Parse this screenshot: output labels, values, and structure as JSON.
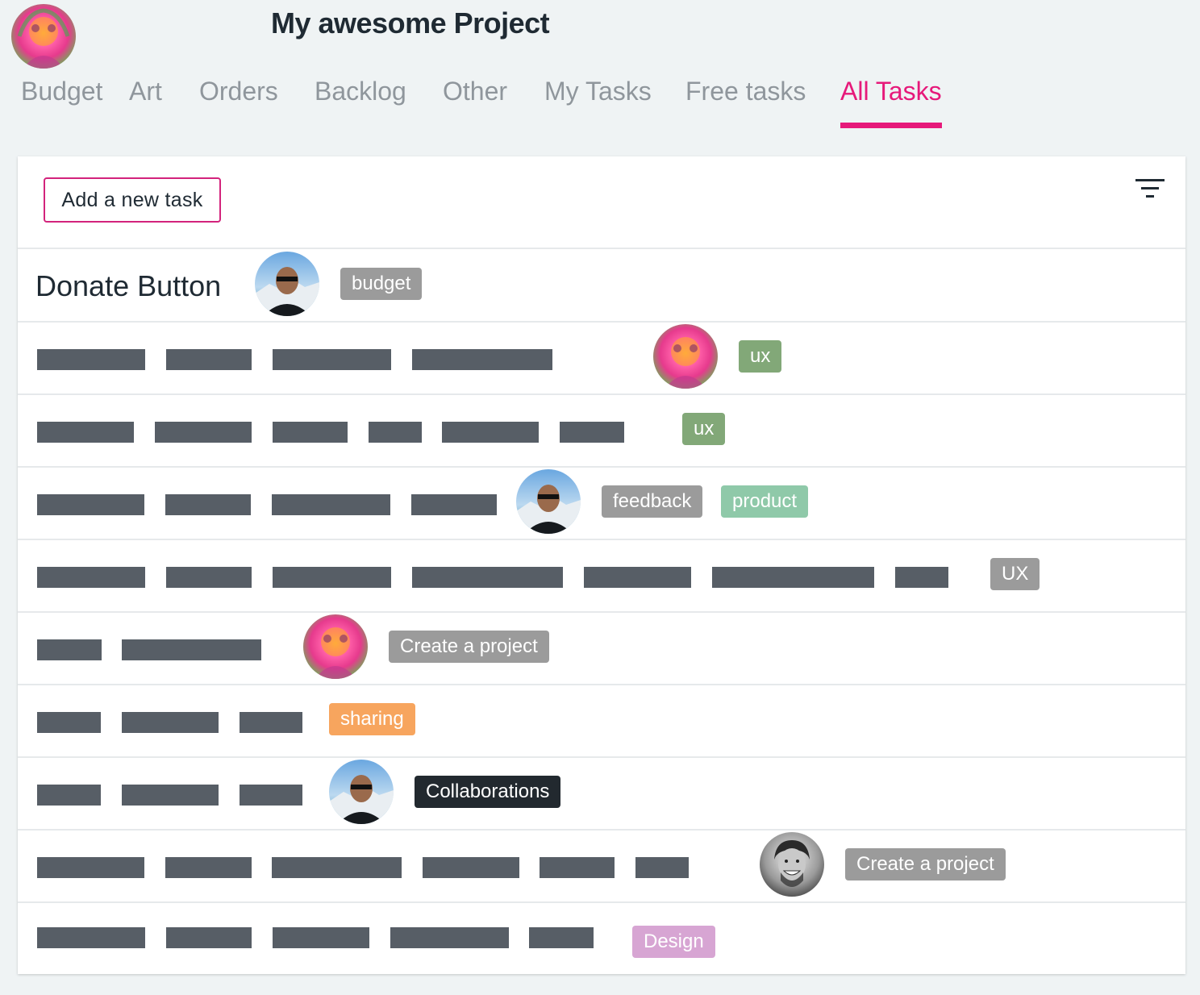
{
  "header": {
    "project_title": "My awesome Project"
  },
  "tabs": [
    {
      "label": "Budget",
      "active": false
    },
    {
      "label": "Art",
      "active": false
    },
    {
      "label": "Orders",
      "active": false
    },
    {
      "label": "Backlog",
      "active": false
    },
    {
      "label": "Other",
      "active": false
    },
    {
      "label": "My Tasks",
      "active": false
    },
    {
      "label": "Free tasks",
      "active": false
    },
    {
      "label": "All Tasks",
      "active": true
    }
  ],
  "toolbar": {
    "add_task_label": "Add a new task",
    "filter_icon": "filter-icon"
  },
  "tasks": [
    {
      "title": "Donate Button",
      "assignee": "man-sunglasses-avatar",
      "tags": [
        {
          "label": "budget",
          "color": "#9b9b9b"
        }
      ]
    },
    {
      "title": "",
      "assignee": "colorful-portrait-avatar",
      "tags": [
        {
          "label": "ux",
          "color": "#82a878"
        }
      ]
    },
    {
      "title": "",
      "assignee": null,
      "tags": [
        {
          "label": "ux",
          "color": "#82a878"
        }
      ]
    },
    {
      "title": "",
      "assignee": "man-sunglasses-avatar",
      "tags": [
        {
          "label": "feedback",
          "color": "#9b9b9b"
        },
        {
          "label": "product",
          "color": "#8fc9a9"
        }
      ]
    },
    {
      "title": "",
      "assignee": null,
      "tags": [
        {
          "label": "UX",
          "color": "#9b9b9b"
        }
      ]
    },
    {
      "title": "",
      "assignee": "colorful-portrait-avatar",
      "tags": [
        {
          "label": "Create a project",
          "color": "#9b9b9b"
        }
      ]
    },
    {
      "title": "",
      "assignee": null,
      "tags": [
        {
          "label": "sharing",
          "color": "#f7a55e"
        }
      ]
    },
    {
      "title": "",
      "assignee": "man-sunglasses-avatar",
      "tags": [
        {
          "label": "Collaborations",
          "color": "#22292f"
        }
      ]
    },
    {
      "title": "",
      "assignee": "smiling-man-bw-avatar",
      "tags": [
        {
          "label": "Create a project",
          "color": "#9b9b9b"
        }
      ]
    },
    {
      "title": "",
      "assignee": null,
      "tags": [
        {
          "label": "Design",
          "color": "#d7a5d3"
        }
      ]
    }
  ],
  "colors": {
    "accent": "#e6197a",
    "tab_inactive": "#8f969c",
    "placeholder_bar": "#575e66",
    "background": "#eff3f4"
  }
}
